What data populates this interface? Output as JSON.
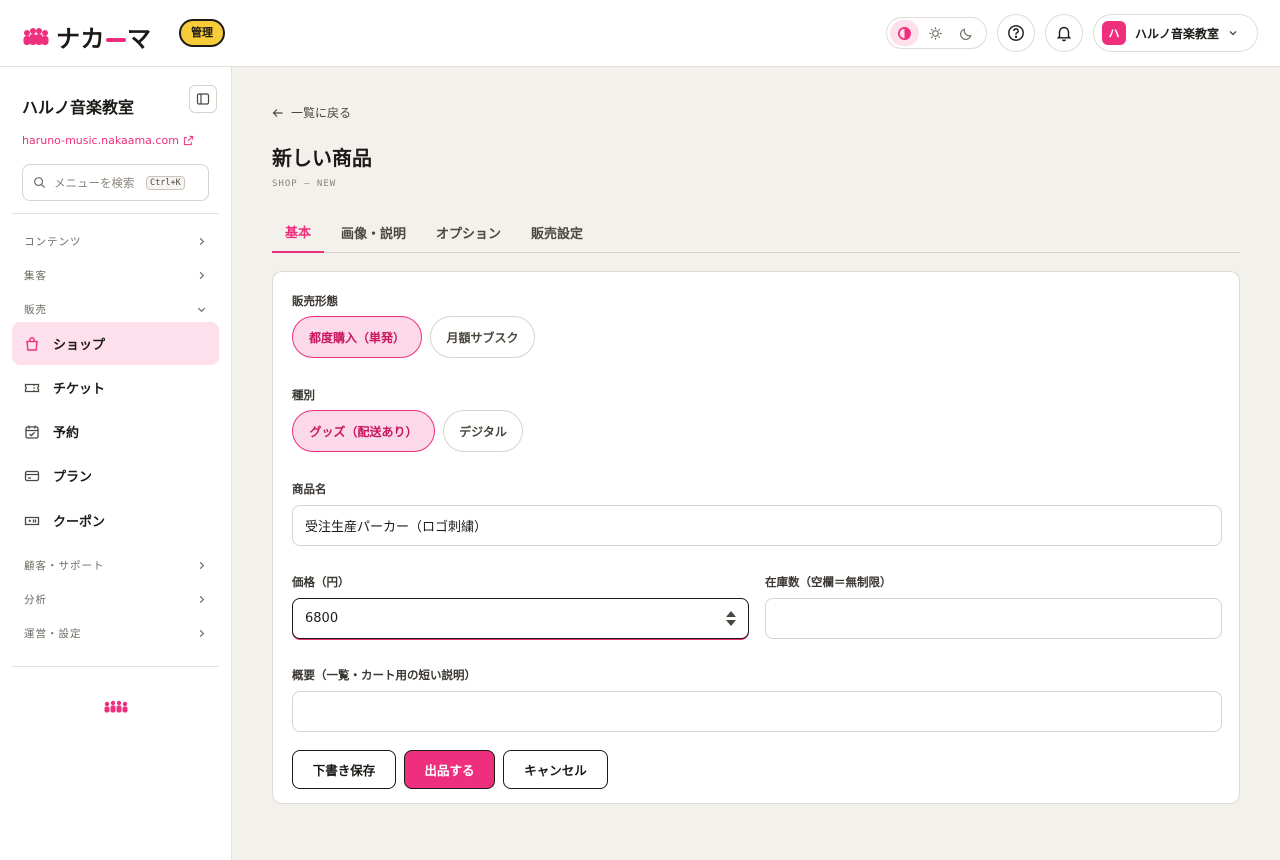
{
  "brand": {
    "name_pre": "ナカ",
    "name_post": "マ",
    "admin_badge": "管理",
    "accent": "#ee2f7d"
  },
  "header": {
    "theme_options": [
      "contrast-icon",
      "sun-icon",
      "moon-icon"
    ],
    "theme_selected": "contrast-icon",
    "account_initial": "ハ",
    "account_name": "ハルノ音楽教室"
  },
  "sidebar": {
    "site_name": "ハルノ音楽教室",
    "site_url": "haruno-music.nakaama.com",
    "search_placeholder": "メニューを検索",
    "search_shortcut": "Ctrl+K",
    "groups": {
      "contents": "コンテンツ",
      "marketing": "集客",
      "sales": "販売",
      "customers": "顧客・サポート",
      "analytics": "分析",
      "operations": "運営・設定"
    },
    "items": {
      "shop": "ショップ",
      "ticket": "チケット",
      "booking": "予約",
      "plan": "プラン",
      "coupon": "クーポン"
    },
    "active_item": "ショップ"
  },
  "main": {
    "back_label": "一覧に戻る",
    "title": "新しい商品",
    "subtitle": "SHOP — NEW",
    "tabs": [
      "基本",
      "画像・説明",
      "オプション",
      "販売設定"
    ],
    "active_tab": "基本"
  },
  "form": {
    "sale_type_label": "販売形態",
    "sale_type_options": [
      "都度購入（単発）",
      "月額サブスク"
    ],
    "sale_type_selected": "都度購入（単発）",
    "kind_label": "種別",
    "kind_options": [
      "グッズ（配送あり）",
      "デジタル"
    ],
    "kind_selected": "グッズ（配送あり）",
    "name_label": "商品名",
    "name_value": "受注生産パーカー（ロゴ刺繍）",
    "price_label": "価格（円）",
    "price_value": "6800",
    "stock_label": "在庫数（空欄＝無制限）",
    "stock_value": "",
    "summary_label": "概要（一覧・カート用の短い説明）",
    "summary_value": ""
  },
  "actions": {
    "draft": "下書き保存",
    "publish": "出品する",
    "cancel": "キャンセル"
  }
}
